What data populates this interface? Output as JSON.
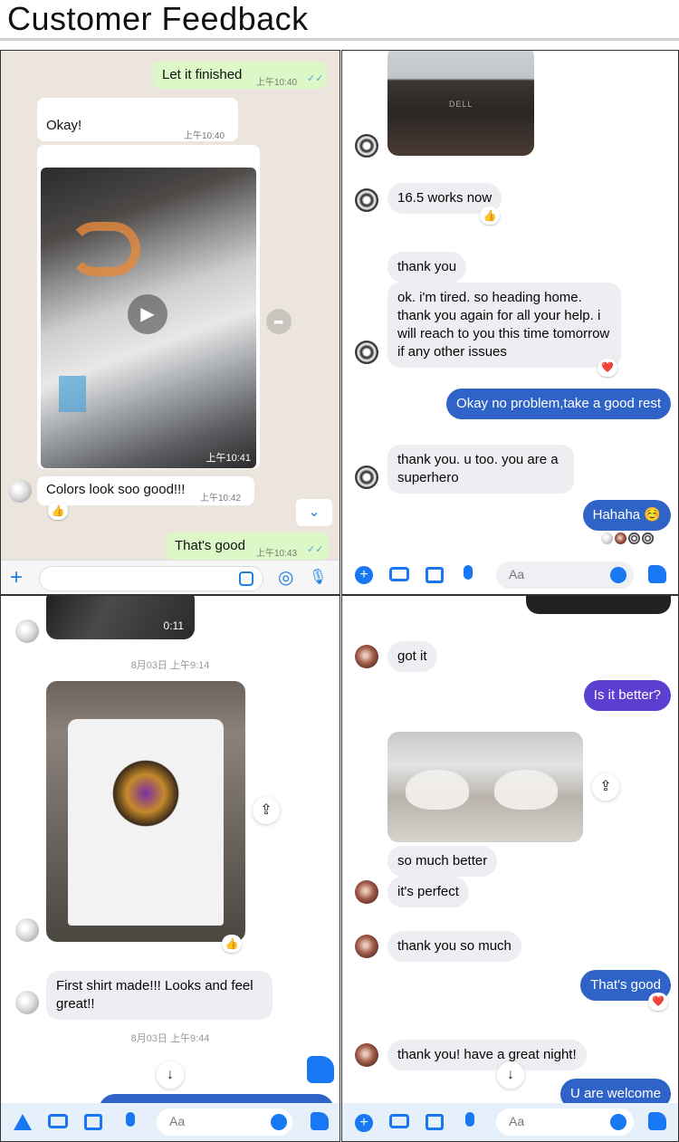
{
  "page_title": "Customer Feedback",
  "panel1": {
    "messages": [
      {
        "text": "Let it finished",
        "time": "上午10:40",
        "ticks": "✓✓"
      },
      {
        "text": "Okay!",
        "time": "上午10:40"
      },
      {
        "video_time": "上午10:41"
      },
      {
        "text": "Colors look soo good!!!",
        "time": "上午10:42",
        "reaction": "👍"
      },
      {
        "text": "That's good",
        "time": "上午10:43",
        "ticks": "✓✓"
      }
    ],
    "icons": {
      "plus": "+",
      "camera": "◎",
      "mic": "🎙",
      "play": "▶",
      "forward": "➦",
      "scroll_down": "⌄"
    }
  },
  "panel2": {
    "messages": [
      {
        "text": "16.5 works now",
        "reaction": "👍"
      },
      {
        "text": "thank you"
      },
      {
        "text": "ok. i'm tired. so heading home. thank you again for all your help.  i will reach to you this time tomorrow if any other issues",
        "reaction": "❤️"
      },
      {
        "text": "Okay no problem,take a good rest"
      },
      {
        "text": "thank you. u too. you are a superhero"
      },
      {
        "text": "Hahaha ☺️"
      }
    ],
    "monitor_brand": "DELL",
    "composer_placeholder": "Aa"
  },
  "panel3": {
    "video_duration": "0:11",
    "date1": "8月03日 上午9:14",
    "reaction": "👍",
    "message": "First shirt made!!! Looks and feel great!!",
    "date2": "8月03日 上午9:44",
    "composer_placeholder": "Aa"
  },
  "panel4": {
    "messages": [
      {
        "text": "got it"
      },
      {
        "text": "Is it better?"
      },
      {
        "text": "so much better"
      },
      {
        "text": "it's perfect"
      },
      {
        "text": "thank you so much"
      },
      {
        "text": "That's good",
        "reaction": "❤️"
      },
      {
        "text": "thank you! have a great night!"
      },
      {
        "text": "U are welcome"
      }
    ],
    "composer_placeholder": "Aa"
  },
  "colors": {
    "whatsapp_bg": "#ece5dd",
    "whatsapp_green": "#dcf8c6",
    "messenger_blue": "#2f63c7",
    "messenger_purple": "#5a3fd0",
    "incoming_gray": "#eceef1"
  }
}
